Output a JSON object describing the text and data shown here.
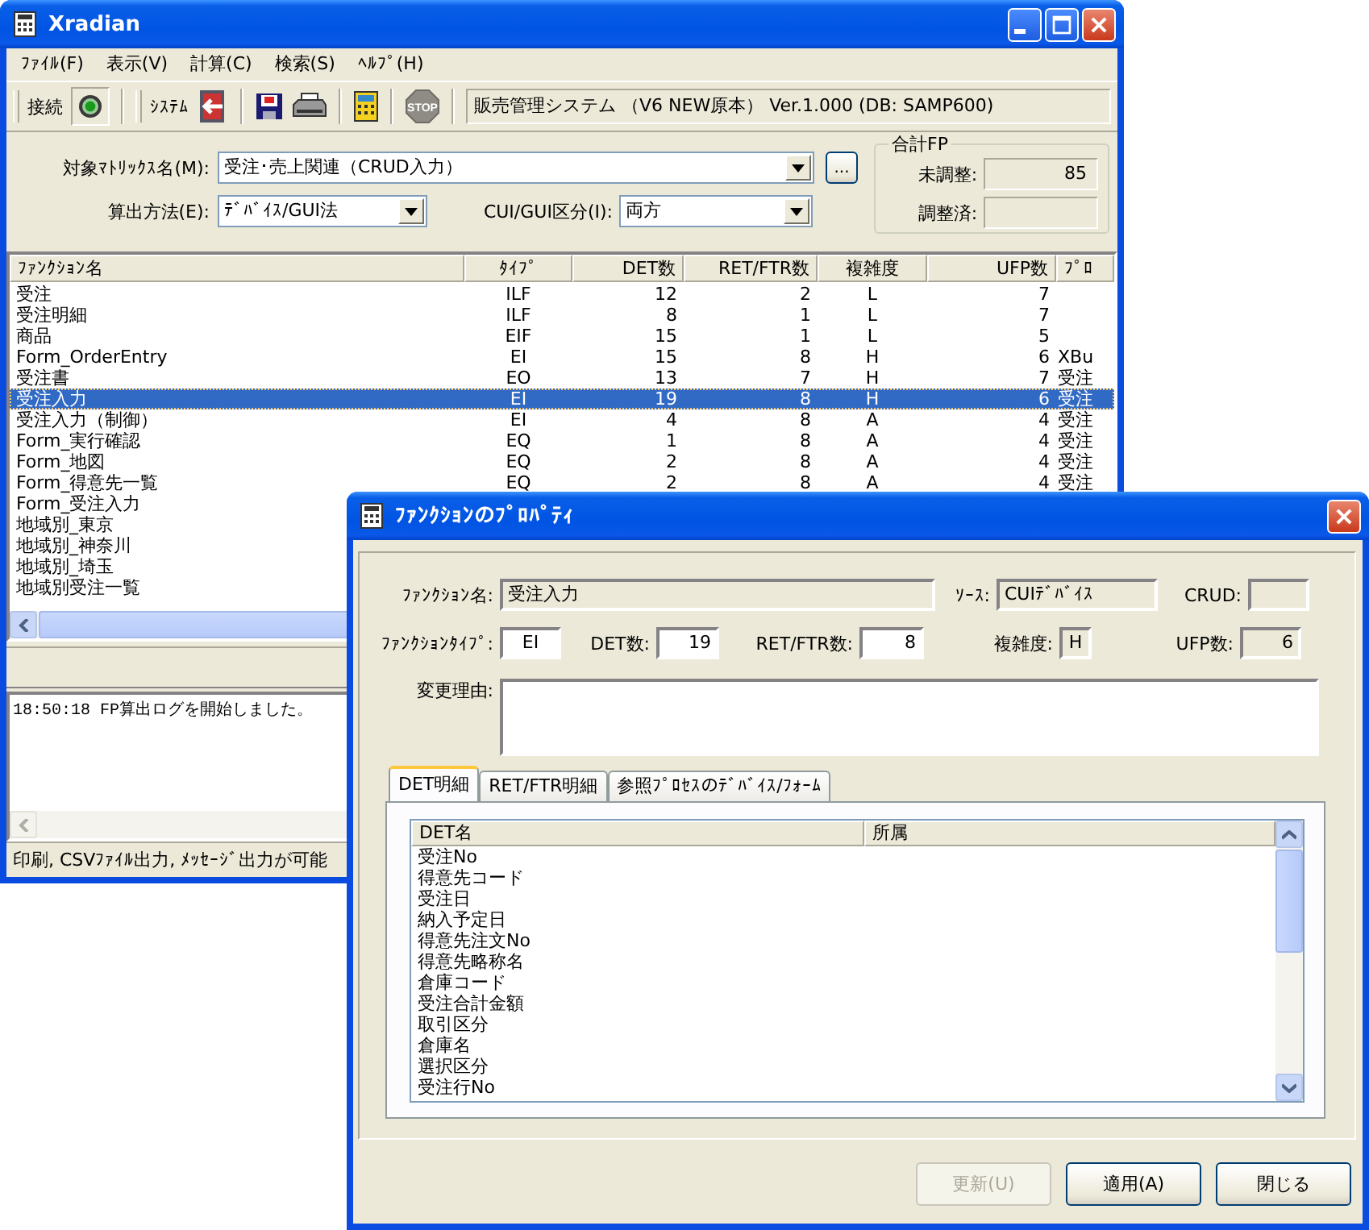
{
  "main_window": {
    "title": "Xradian",
    "menu": [
      {
        "label": "ﾌｧｲﾙ(F)"
      },
      {
        "label": "表示(V)"
      },
      {
        "label": "計算(C)"
      },
      {
        "label": "検索(S)"
      },
      {
        "label": "ﾍﾙﾌﾟ(H)"
      }
    ],
    "toolbar": {
      "connect_label": "接続",
      "system_label": "ｼｽﾃﾑ",
      "stop_label": "STOP",
      "system_info": "販売管理システム （V6 NEW原本） Ver.1.000 (DB: SAMP600)"
    },
    "form": {
      "matrix": {
        "label": "対象ﾏﾄﾘｯｸｽ名(M):",
        "value": "受注･売上関連（CRUD入力）"
      },
      "browse_button": "...",
      "method": {
        "label": "算出方法(E):",
        "value": "ﾃﾞﾊﾞｲｽ/GUI法"
      },
      "cui_gui": {
        "label": "CUI/GUI区分(I):",
        "value": "両方"
      }
    },
    "total_fp": {
      "title": "合計FP",
      "unadjusted": {
        "label": "未調整:",
        "value": "85"
      },
      "adjusted": {
        "label": "調整済:"
      }
    },
    "table": {
      "columns": [
        "ﾌｧﾝｸｼｮﾝ名",
        "ﾀｲﾌﾟ",
        "DET数",
        "RET/FTR数",
        "複雑度",
        "UFP数",
        "ﾌﾟﾛ"
      ],
      "rows": [
        {
          "cells": [
            "受注",
            "ILF",
            "12",
            "2",
            "L",
            "7"
          ],
          "selected": false
        },
        {
          "cells": [
            "受注明細",
            "ILF",
            "8",
            "1",
            "L",
            "7"
          ],
          "selected": false
        },
        {
          "cells": [
            "商品",
            "EIF",
            "15",
            "1",
            "L",
            "5"
          ],
          "selected": false
        },
        {
          "cells": [
            "Form_OrderEntry",
            "EI",
            "15",
            "8",
            "H",
            "6",
            "XBu"
          ],
          "selected": false
        },
        {
          "cells": [
            "受注書",
            "EO",
            "13",
            "7",
            "H",
            "7",
            "受注"
          ],
          "selected": false
        },
        {
          "cells": [
            "受注入力",
            "EI",
            "19",
            "8",
            "H",
            "6",
            "受注"
          ],
          "selected": true
        },
        {
          "cells": [
            "受注入力（制御）",
            "EI",
            "4",
            "8",
            "A",
            "4",
            "受注"
          ],
          "selected": false
        },
        {
          "cells": [
            "Form_実行確認",
            "EQ",
            "1",
            "8",
            "A",
            "4",
            "受注"
          ],
          "selected": false
        },
        {
          "cells": [
            "Form_地図",
            "EQ",
            "2",
            "8",
            "A",
            "4",
            "受注"
          ],
          "selected": false
        },
        {
          "cells": [
            "Form_得意先一覧",
            "EQ",
            "2",
            "8",
            "A",
            "4",
            "受注"
          ],
          "selected": false
        },
        {
          "cells": [
            "Form_受注入力"
          ],
          "selected": false
        },
        {
          "cells": [
            "地域別_東京"
          ],
          "selected": false
        },
        {
          "cells": [
            "地域別_神奈川"
          ],
          "selected": false
        },
        {
          "cells": [
            "地域別_埼玉"
          ],
          "selected": false
        },
        {
          "cells": [
            "地域別受注一覧"
          ],
          "selected": false
        }
      ]
    },
    "log": [
      "18:50:18 FP算出ログを開始しました。"
    ],
    "status_bar": "印刷, CSVﾌｧｲﾙ出力, ﾒｯｾｰｼﾞ出力が可能"
  },
  "dialog": {
    "title": "ﾌｧﾝｸｼｮﾝのﾌﾟﾛﾊﾟﾃｨ",
    "field_rows": [
      [
        {
          "label": "ﾌｧﾝｸｼｮﾝ名:",
          "value": "受注入力",
          "readonly": true
        },
        {
          "label": "ｿｰｽ:",
          "value": "CUIﾃﾞﾊﾞｲｽ",
          "readonly": true
        },
        {
          "label": "CRUD:",
          "readonly": true
        }
      ],
      [
        {
          "label": "ﾌｧﾝｸｼｮﾝﾀｲﾌﾟ:",
          "value": "EI",
          "readonly": false
        },
        {
          "label": "DET数:",
          "value": "19",
          "readonly": false
        },
        {
          "label": "RET/FTR数:",
          "value": "8",
          "readonly": false
        },
        {
          "label": "複雑度:",
          "value": "H",
          "readonly": true
        },
        {
          "label": "UFP数:",
          "value": "6",
          "readonly": true
        }
      ]
    ],
    "reason": {
      "label": "変更理由:"
    },
    "tabs": [
      {
        "label": "DET明細",
        "selected": true
      },
      {
        "label": "RET/FTR明細",
        "selected": false
      },
      {
        "label": "参照ﾌﾟﾛｾｽのﾃﾞﾊﾞｲｽ/ﾌｫｰﾑ",
        "selected": false
      }
    ],
    "det_table": {
      "columns": [
        "DET名",
        "所属"
      ],
      "rows": [
        "受注No",
        "得意先コード",
        "受注日",
        "納入予定日",
        "得意先注文No",
        "得意先略称名",
        "倉庫コード",
        "受注合計金額",
        "取引区分",
        "倉庫名",
        "選択区分",
        "受注行No"
      ]
    },
    "buttons": [
      {
        "label": "更新(U)",
        "disabled": true
      },
      {
        "label": "適用(A)",
        "disabled": false
      },
      {
        "label": "閉じる",
        "disabled": false
      }
    ]
  }
}
